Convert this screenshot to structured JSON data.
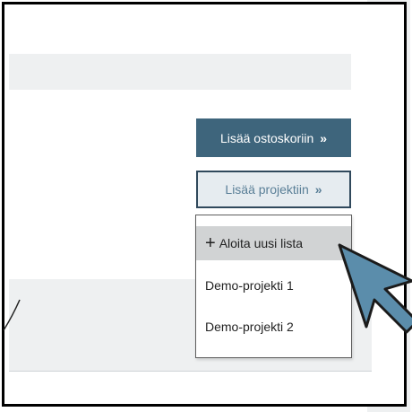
{
  "product": {
    "add_to_cart_label": "Lisää ostoskoriin",
    "add_to_project_label": "Lisää projektiin"
  },
  "dropdown": {
    "items": [
      {
        "label": "Aloita uusi lista",
        "icon": "plus-icon",
        "highlighted": true
      },
      {
        "label": "Demo-projekti 1"
      },
      {
        "label": "Demo-projekti 2"
      }
    ]
  },
  "icons": {
    "chevron": "»",
    "plus": "+"
  },
  "colors": {
    "primary_button": "#3e657c",
    "secondary_button_bg": "#e6ecf0",
    "secondary_button_text": "#5a7f97",
    "highlight": "#d1d3d4",
    "arrow": "#5b8dab"
  }
}
